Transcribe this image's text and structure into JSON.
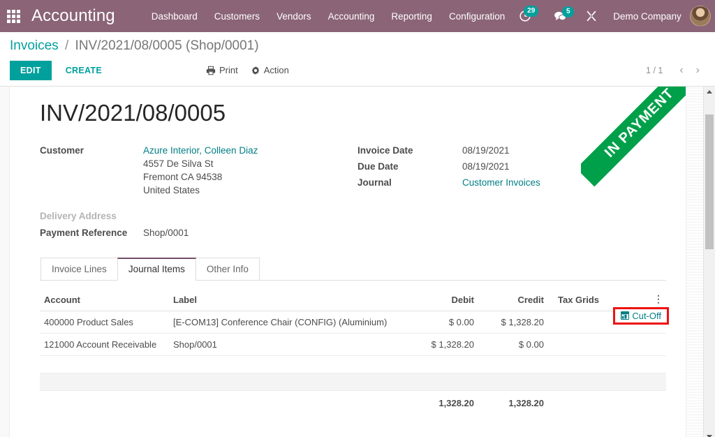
{
  "navbar": {
    "apps_icon": "apps-grid-icon",
    "brand": "Accounting",
    "menu": [
      {
        "label": "Dashboard"
      },
      {
        "label": "Customers"
      },
      {
        "label": "Vendors"
      },
      {
        "label": "Accounting"
      },
      {
        "label": "Reporting"
      },
      {
        "label": "Configuration"
      }
    ],
    "activities": {
      "icon": "clock-icon",
      "count": "29"
    },
    "messages": {
      "icon": "chat-bubble-icon",
      "count": "5"
    },
    "developer_tools": {
      "icon": "wrench-icon"
    },
    "company": "Demo Company",
    "avatar": "user-avatar"
  },
  "control_panel": {
    "breadcrumb": {
      "root": "Invoices",
      "separator": "/",
      "current": "INV/2021/08/0005 (Shop/0001)"
    },
    "edit_label": "EDIT",
    "create_label": "CREATE",
    "print_label": "Print",
    "print_icon": "printer-icon",
    "action_label": "Action",
    "action_icon": "gear-icon",
    "pager": {
      "value": "1 / 1",
      "prev_icon": "chevron-left-icon",
      "next_icon": "chevron-right-icon"
    }
  },
  "sheet": {
    "ribbon": "IN PAYMENT",
    "title": "INV/2021/08/0005",
    "left_fields": {
      "customer_label": "Customer",
      "customer_name": "Azure Interior, Colleen Diaz",
      "address": [
        "4557 De Silva St",
        "Fremont CA 94538",
        "United States"
      ],
      "delivery_address_label": "Delivery Address",
      "delivery_address_value": "",
      "payment_reference_label": "Payment Reference",
      "payment_reference_value": "Shop/0001"
    },
    "right_fields": [
      {
        "label": "Invoice Date",
        "value": "08/19/2021",
        "link": false
      },
      {
        "label": "Due Date",
        "value": "08/19/2021",
        "link": false
      },
      {
        "label": "Journal",
        "value": "Customer Invoices",
        "link": true
      }
    ]
  },
  "notebook": {
    "tabs": [
      {
        "label": "Invoice Lines",
        "active": false
      },
      {
        "label": "Journal Items",
        "active": true
      },
      {
        "label": "Other Info",
        "active": false
      }
    ]
  },
  "journal_items": {
    "columns": [
      "Account",
      "Label",
      "Debit",
      "Credit",
      "Tax Grids"
    ],
    "optional_columns_icon": "vertical-dots-icon",
    "rows": [
      {
        "account": "400000 Product Sales",
        "label": "[E-COM13] Conference Chair (CONFIG) (Aluminium)",
        "debit": "$ 0.00",
        "credit": "$ 1,328.20",
        "tax_grids": "",
        "cutoff_button": "Cut-Off",
        "cutoff_icon": "calendar-icon",
        "highlighted": true
      },
      {
        "account": "121000 Account Receivable",
        "label": "Shop/0001",
        "debit": "$ 1,328.20",
        "credit": "$ 0.00",
        "tax_grids": "",
        "cutoff_button": "",
        "highlighted": false
      }
    ],
    "totals": {
      "debit": "1,328.20",
      "credit": "1,328.20"
    }
  },
  "colors": {
    "navbar": "#8b6477",
    "accent_teal": "#00a09d",
    "ribbon_green": "#00a04a",
    "highlight_red": "#ee1111",
    "tab_active_border": "#714b67"
  }
}
